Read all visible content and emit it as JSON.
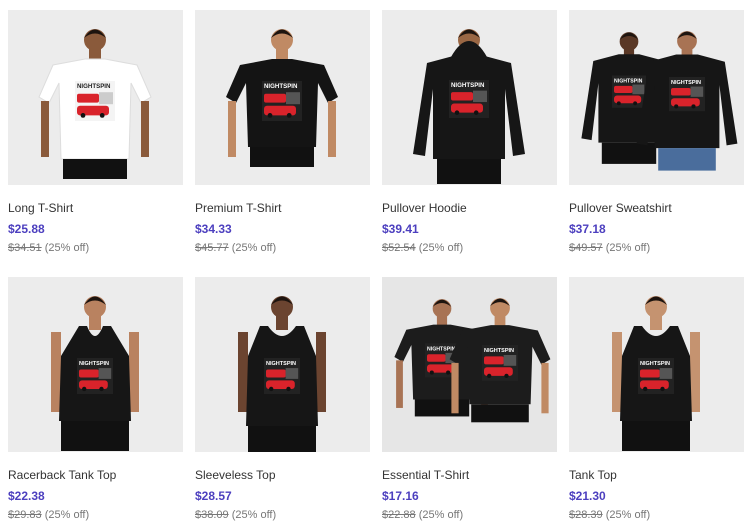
{
  "products": [
    {
      "name": "Long T-Shirt",
      "price": "$25.88",
      "original_price": "$34.51",
      "discount": "(25% off)",
      "garment": "long-tee",
      "garment_color": "#ffffff",
      "models": 1
    },
    {
      "name": "Premium T-Shirt",
      "price": "$34.33",
      "original_price": "$45.77",
      "discount": "(25% off)",
      "garment": "tee",
      "garment_color": "#141414",
      "models": 1
    },
    {
      "name": "Pullover Hoodie",
      "price": "$39.41",
      "original_price": "$52.54",
      "discount": "(25% off)",
      "garment": "hoodie",
      "garment_color": "#161616",
      "models": 1
    },
    {
      "name": "Pullover Sweatshirt",
      "price": "$37.18",
      "original_price": "$49.57",
      "discount": "(25% off)",
      "garment": "sweatshirt",
      "garment_color": "#161616",
      "models": 2
    },
    {
      "name": "Racerback Tank Top",
      "price": "$22.38",
      "original_price": "$29.83",
      "discount": "(25% off)",
      "garment": "racerback",
      "garment_color": "#161616",
      "models": 1
    },
    {
      "name": "Sleeveless Top",
      "price": "$28.57",
      "original_price": "$38.09",
      "discount": "(25% off)",
      "garment": "sleeveless",
      "garment_color": "#161616",
      "models": 1
    },
    {
      "name": "Essential T-Shirt",
      "price": "$17.16",
      "original_price": "$22.88",
      "discount": "(25% off)",
      "garment": "tee",
      "garment_color": "#1c1c1c",
      "models": 2
    },
    {
      "name": "Tank Top",
      "price": "$21.30",
      "original_price": "$28.39",
      "discount": "(25% off)",
      "garment": "tank",
      "garment_color": "#161616",
      "models": 1
    }
  ],
  "colors": {
    "price": "#4c3fbf",
    "thumb_background": "#ececec",
    "print_red": "#d9232b"
  },
  "print_text": "NIGHTSPIN"
}
